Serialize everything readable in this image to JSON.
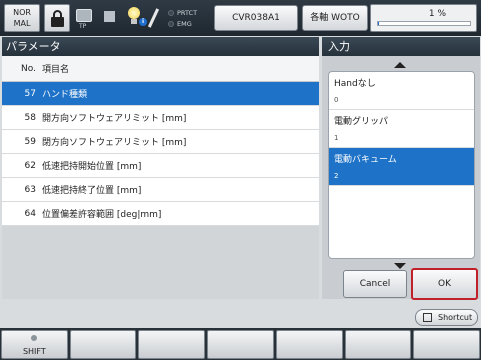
{
  "status_bar": {
    "mode_line1": "NOR",
    "mode_line2": "MAL",
    "tp_label": "TP",
    "prtct_label": "PRTCT",
    "emg_label": "EMG",
    "robot_name": "CVR038A1",
    "axis_label": "各軸 WOTO",
    "speed_value": "1 %",
    "speed_fraction": 0.01
  },
  "param_panel": {
    "title": "パラメータ",
    "col_no": "No.",
    "col_name": "項目名",
    "rows": [
      {
        "no": "57",
        "name": "ハンド種類"
      },
      {
        "no": "58",
        "name": "開方向ソフトウェアリミット [mm]"
      },
      {
        "no": "59",
        "name": "閉方向ソフトウェアリミット [mm]"
      },
      {
        "no": "62",
        "name": "低速把持開始位置 [mm]"
      },
      {
        "no": "63",
        "name": "低速把持終了位置 [mm]"
      },
      {
        "no": "64",
        "name": "位置偏差許容範囲 [deg|mm]"
      }
    ]
  },
  "input_panel": {
    "title": "入力",
    "options": [
      {
        "label": "Handなし",
        "index": "0"
      },
      {
        "label": "電動グリッパ",
        "index": "1"
      },
      {
        "label": "電動バキューム",
        "index": "2"
      }
    ],
    "cancel_label": "Cancel",
    "ok_label": "OK"
  },
  "shortcut_label": "Shortcut",
  "fkeys": [
    "SHIFT",
    "",
    "",
    "",
    "",
    "",
    ""
  ],
  "colors": {
    "selection": "#1e73c8",
    "ok_border": "#c0202a",
    "header": "#2f3a45"
  }
}
